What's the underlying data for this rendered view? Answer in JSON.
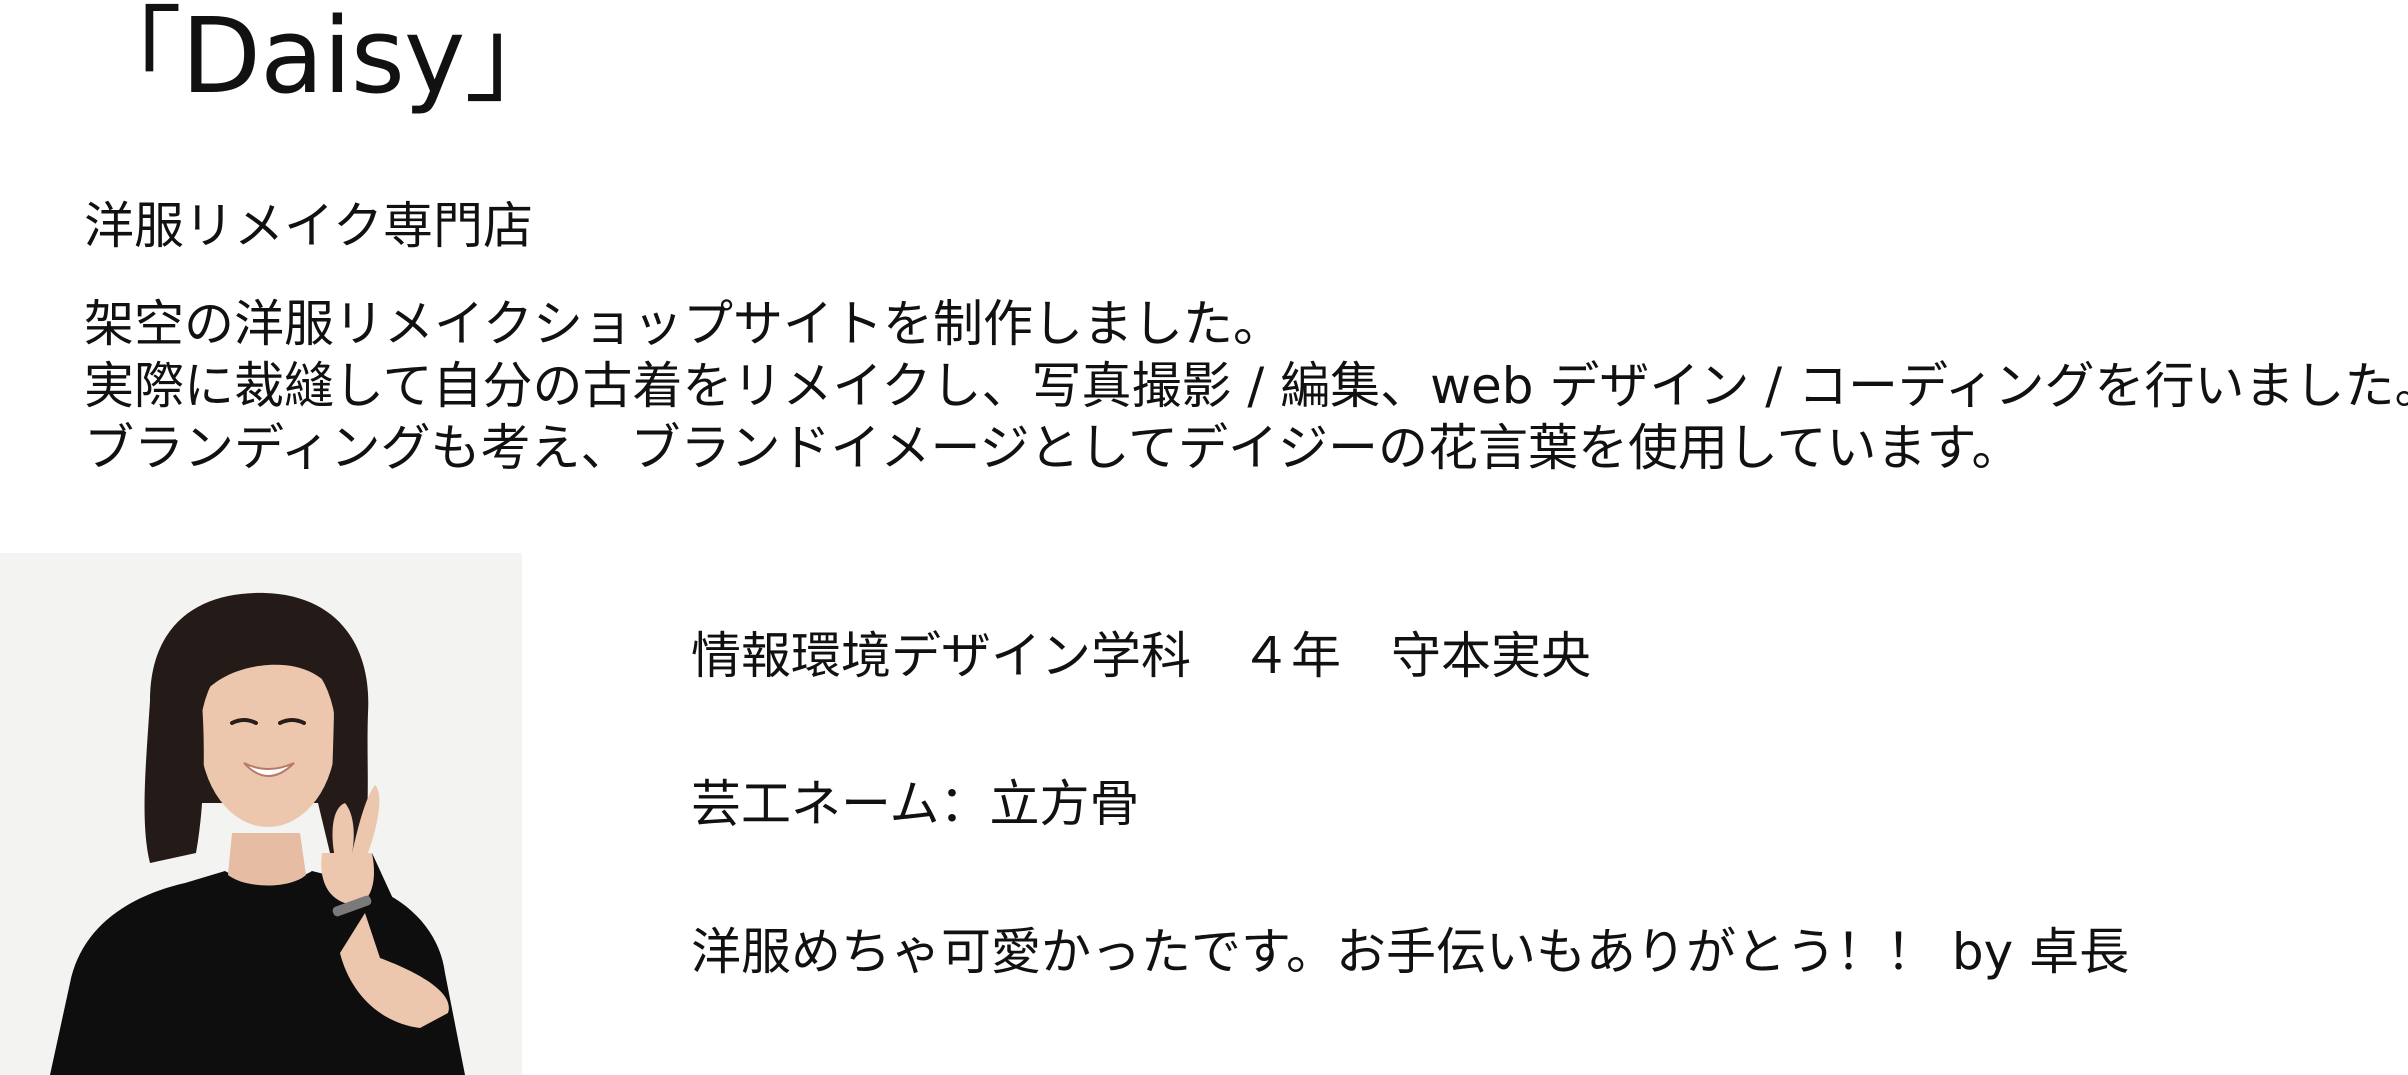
{
  "work": {
    "title": "「Daisy」",
    "subtitle": "洋服リメイク専門店",
    "description": [
      "架空の洋服リメイクショップサイトを制作しました。",
      "実際に裁縫して自分の古着をリメイクし、写真撮影 / 編集、web デザイン / コーディングを行いました。",
      "ブランディングも考え、ブランドイメージとしてデイジーの花言葉を使用しています。"
    ]
  },
  "student": {
    "affiliation": "情報環境デザイン学科　４年　守本実央",
    "nickname": "芸工ネーム：立方骨",
    "comment": "洋服めちゃ可愛かったです。お手伝いもありがとう！！ by 卓長"
  },
  "photo": {
    "icon": "student-portrait",
    "background_color": "#f3f3f2",
    "shirt_color": "#0e0e0e",
    "hair_color": "#241b18",
    "skin_color": "#ecc7ae"
  }
}
